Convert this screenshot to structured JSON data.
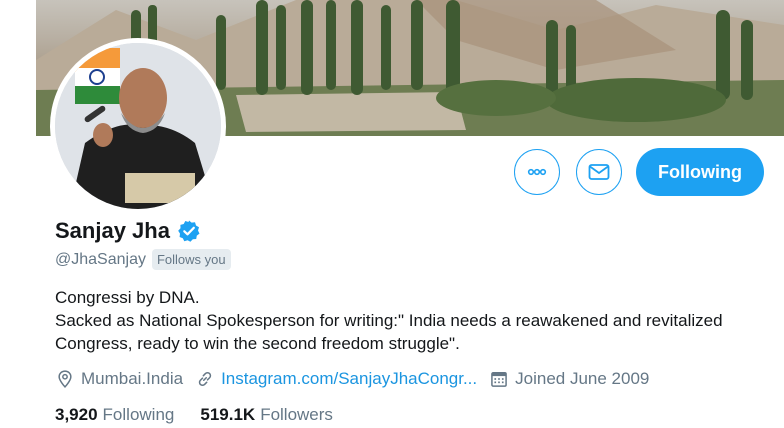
{
  "profile": {
    "name": "Sanjay Jha",
    "handle": "@JhaSanjay",
    "follows_you": "Follows you",
    "bio_line1": "Congressi by DNA.",
    "bio_line2": "Sacked as National Spokesperson for writing:\" India needs a reawakened and revitalized Congress, ready to win the second freedom struggle\".",
    "location": "Mumbai.India",
    "website": "Instagram.com/SanjayJhaCongr...",
    "joined": "Joined June 2009"
  },
  "actions": {
    "following_label": "Following"
  },
  "stats": {
    "following_count": "3,920",
    "following_label": "Following",
    "followers_count": "519.1K",
    "followers_label": "Followers"
  },
  "icons": {
    "more": "more-horizontal-icon",
    "message": "envelope-icon",
    "verified": "verified-badge-icon",
    "location": "location-pin-icon",
    "link": "link-icon",
    "calendar": "calendar-icon"
  },
  "colors": {
    "accent": "#1da1f2",
    "link": "#1b95e0",
    "secondary_text": "#657786",
    "primary_text": "#14171a"
  }
}
